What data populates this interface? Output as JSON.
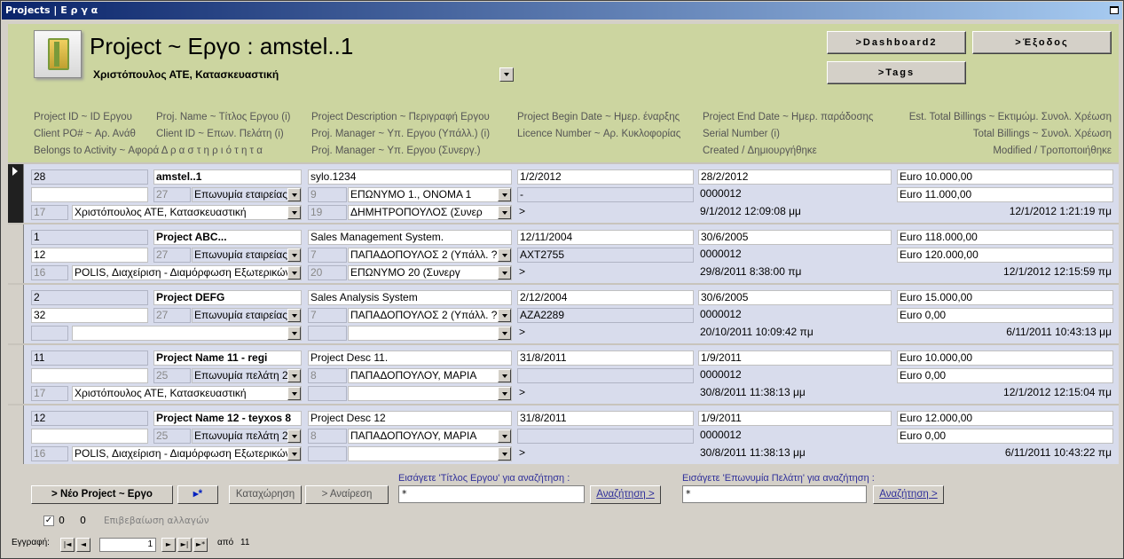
{
  "window": {
    "title": "Projects | Ε ρ γ α"
  },
  "header": {
    "title": "Project ~ Εργο : amstel..1",
    "subtitle": "Χριστόπουλος ΑΤΕ, Κατασκευαστική",
    "buttons": {
      "dashboard": ">Dashboard2",
      "exit": ">Έξοδος",
      "tags": ">Tags"
    }
  },
  "labels": {
    "c1": [
      "Project ID ~ ID Εργου",
      "Client PO# ~ Αρ. Ανάθ",
      "Belongs to Activity ~ Αφορά  Δ ρ α σ τ η ρ ι ό τ η τ α"
    ],
    "c2": [
      "Proj. Name ~ Τίτλος Εργου (i)",
      "Client ID ~ Επων. Πελάτη (i)"
    ],
    "c3": [
      "Project Description ~ Περιγραφή Εργου",
      "Proj. Manager ~ Υπ. Εργου (Υπάλλ.) (i)",
      "Proj. Manager ~ Υπ. Εργου (Συνεργ.)"
    ],
    "c4": [
      "Project Begin Date ~ Ημερ. έναρξης",
      "Licence Number ~ Αρ. Κυκλοφορίας"
    ],
    "c5": [
      "Project End Date ~ Ημερ. παράδοσης",
      "Serial Number (i)",
      "Created / Δημιουργήθηκε"
    ],
    "c6": [
      "Est. Total Billings ~ Εκτιμώμ. Συνολ. Χρέωση",
      "Total Billings ~ Συνολ. Χρέωση",
      "Modified / Τροποποιήθηκε"
    ]
  },
  "records": [
    {
      "id": "28",
      "name": "amstel..1",
      "desc": "sylo.1234",
      "begin": "1/2/2012",
      "end": "28/2/2012",
      "est": "Euro 10.000,00",
      "po": "",
      "client_id": "27",
      "client": "Επωνυμία εταιρείας",
      "mgr_id": "9",
      "mgr": "ΕΠΩΝΥΜΟ 1., ΟΝΟΜΑ 1",
      "licence": "-",
      "serial": "0000012",
      "total": "Euro 11.000,00",
      "act_id": "17",
      "activity": "Χριστόπουλος ΑΤΕ, Κατασκευαστική",
      "partner_id": "19",
      "partner": "ΔΗΜΗΤΡΟΠΟΥΛΟΣ (Συνερ",
      "gt": ">",
      "created": "9/1/2012 12:09:08 μμ",
      "modified": "12/1/2012 1:21:19 πμ"
    },
    {
      "id": "1",
      "name": "Project ABC...",
      "desc": "Sales Management System.",
      "begin": "12/11/2004",
      "end": "30/6/2005",
      "est": "Euro 118.000,00",
      "po": "12",
      "client_id": "27",
      "client": "Επωνυμία εταιρείας",
      "mgr_id": "7",
      "mgr": "ΠΑΠΑΔΟΠΟΥΛΟΣ 2 (Υπάλλ. ?",
      "licence": "ΑΧΤ2755",
      "serial": "0000012",
      "total": "Euro 120.000,00",
      "act_id": "16",
      "activity": "POLIS, Διαχείριση - Διαμόρφωση Εξωτερικών",
      "partner_id": "20",
      "partner": "ΕΠΩΝΥΜΟ 20 (Συνεργ",
      "gt": ">",
      "created": "29/8/2011 8:38:00 πμ",
      "modified": "12/1/2012 12:15:59 πμ"
    },
    {
      "id": "2",
      "name": "Project DEFG",
      "desc": "Sales Analysis System",
      "begin": "2/12/2004",
      "end": "30/6/2005",
      "est": "Euro 15.000,00",
      "po": "32",
      "client_id": "27",
      "client": "Επωνυμία εταιρείας",
      "mgr_id": "7",
      "mgr": "ΠΑΠΑΔΟΠΟΥΛΟΣ 2 (Υπάλλ. ?",
      "licence": "ΑΖΑ2289",
      "serial": "0000012",
      "total": "Euro 0,00",
      "act_id": "",
      "activity": "",
      "partner_id": "",
      "partner": "",
      "gt": ">",
      "created": "20/10/2011 10:09:42 πμ",
      "modified": "6/11/2011 10:43:13 μμ"
    },
    {
      "id": "11",
      "name": "Project Name 11 - regi",
      "desc": "Project Desc 11.",
      "begin": "31/8/2011",
      "end": "1/9/2011",
      "est": "Euro 10.000,00",
      "po": "",
      "client_id": "25",
      "client": "Επωνυμία πελάτη 2",
      "mgr_id": "8",
      "mgr": "ΠΑΠΑΔΟΠΟΥΛΟΥ, ΜΑΡΙΑ",
      "licence": "",
      "serial": "0000012",
      "total": "Euro 0,00",
      "act_id": "17",
      "activity": "Χριστόπουλος ΑΤΕ, Κατασκευαστική",
      "partner_id": "",
      "partner": "",
      "gt": ">",
      "created": "30/8/2011 11:38:13 μμ",
      "modified": "12/1/2012 12:15:04 πμ"
    },
    {
      "id": "12",
      "name": "Project Name 12 - teyxos 8",
      "desc": "Project Desc 12",
      "begin": "31/8/2011",
      "end": "1/9/2011",
      "est": "Euro 12.000,00",
      "po": "",
      "client_id": "25",
      "client": "Επωνυμία πελάτη 2",
      "mgr_id": "8",
      "mgr": "ΠΑΠΑΔΟΠΟΥΛΟΥ, ΜΑΡΙΑ",
      "licence": "",
      "serial": "0000012",
      "total": "Euro 0,00",
      "act_id": "16",
      "activity": "POLIS, Διαχείριση - Διαμόρφωση Εξωτερικών",
      "partner_id": "",
      "partner": "",
      "gt": ">",
      "created": "30/8/2011 11:38:13 μμ",
      "modified": "6/11/2011 10:43:22 πμ"
    }
  ],
  "footer": {
    "new_project": "> Νέο Project ~ Εργο",
    "new_record_icon": "▸*",
    "save": "Καταχώρηση",
    "undo": "> Αναίρεση",
    "search_title_label": "Εισάγετε 'Τίτλος Εργου' για αναζήτηση :",
    "search_title_value": "*",
    "search_button": "Αναζήτηση >",
    "search_client_label": "Εισάγετε 'Επωνυμία Πελάτη' για αναζήτηση :",
    "search_client_value": "*",
    "check_a": "0",
    "check_b": "0",
    "confirm_label": "Επιβεβαίωση αλλαγών"
  },
  "navigation": {
    "label": "Εγγραφή:",
    "current": "1",
    "of": "από",
    "total": "11",
    "first": "|◄",
    "prev": "◄",
    "next": "►",
    "last": "►|",
    "new": "►*"
  }
}
